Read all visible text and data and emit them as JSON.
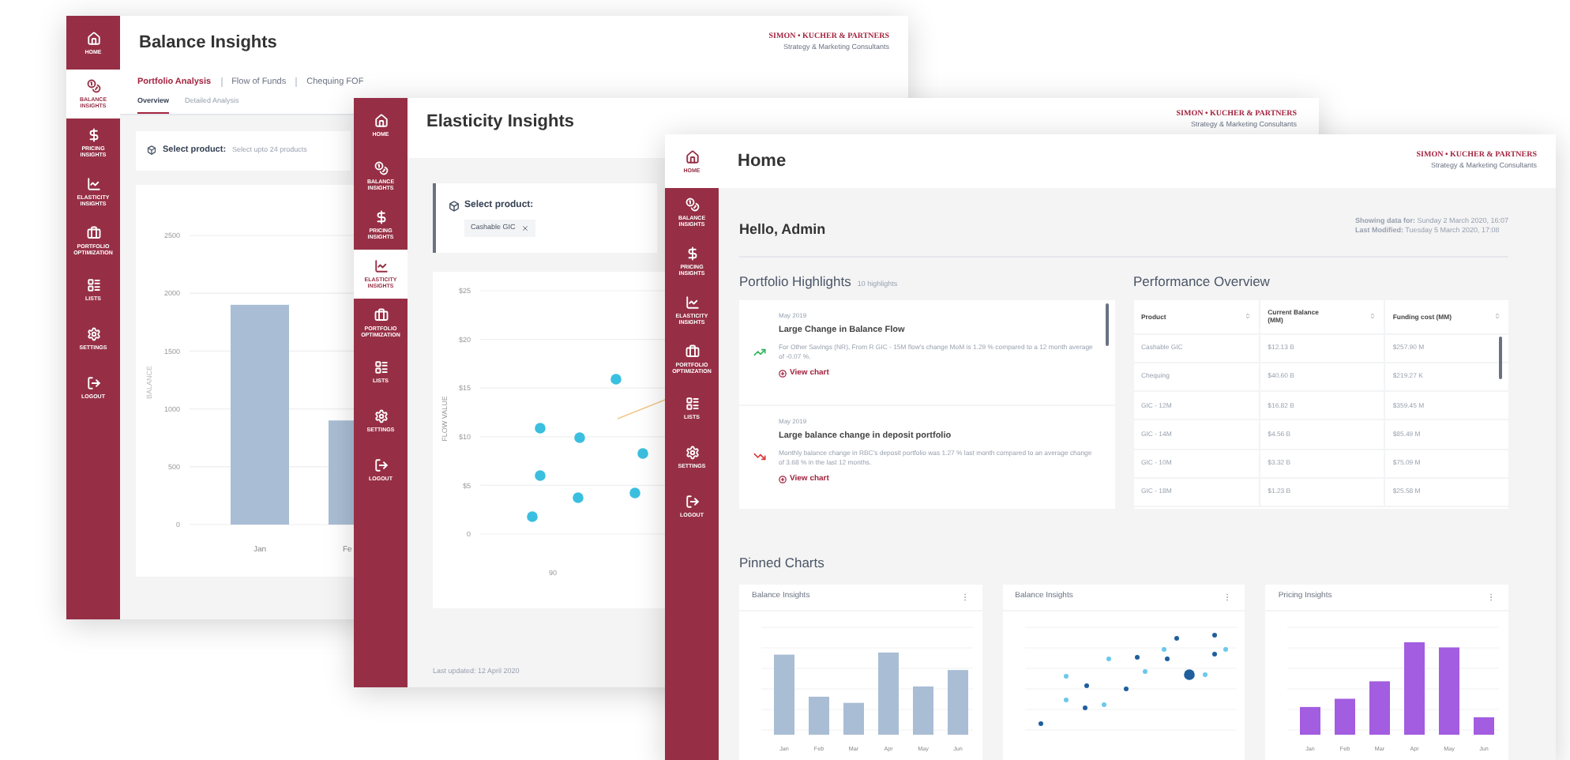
{
  "windows": [
    {
      "kind": "balance",
      "title": "Balance Insights",
      "logo": {
        "name": "SIMON • KUCHER & PARTNERS",
        "tagline": "Strategy & Marketing Consultants"
      },
      "sidebar": [
        {
          "label": "HOME",
          "selected": false
        },
        {
          "label": "BALANCE INSIGHTS",
          "selected": true
        },
        {
          "label": "PRICING INSIGHTS",
          "selected": false
        },
        {
          "label": "ELASTICITY INSIGHTS",
          "selected": false
        },
        {
          "label": "PORTFOLIO OPTIMIZATION",
          "selected": false
        },
        {
          "label": "LISTS",
          "selected": false
        },
        {
          "label": "SETTINGS",
          "selected": false
        },
        {
          "label": "LOGOUT",
          "selected": false
        }
      ],
      "tabs": [
        {
          "label": "Portfolio Analysis",
          "selected": true
        },
        {
          "label": "Flow of Funds",
          "selected": false
        },
        {
          "label": "Chequing FOF",
          "selected": false
        }
      ],
      "subtabs": [
        {
          "label": "Overview",
          "selected": true
        },
        {
          "label": "Detailed Analysis",
          "selected": false
        }
      ],
      "product_select": {
        "label": "Select product:",
        "placeholder": "Select upto 24 products"
      },
      "chart": {
        "chart_data": {
          "type": "bar",
          "grid": true,
          "ylabel": "BALANCE",
          "categories": [
            "Jan",
            "Fe"
          ],
          "values": [
            1900,
            900
          ],
          "ylim": [
            0,
            2500
          ],
          "yticks": [
            0,
            500,
            1000,
            1500,
            2000,
            2500
          ]
        }
      }
    },
    {
      "kind": "elasticity",
      "title": "Elasticity Insights",
      "logo": {
        "name": "SIMON • KUCHER & PARTNERS",
        "tagline": "Strategy & Marketing Consultants"
      },
      "sidebar": [
        {
          "label": "HOME",
          "selected": false
        },
        {
          "label": "BALANCE INSIGHTS",
          "selected": false
        },
        {
          "label": "PRICING INSIGHTS",
          "selected": false
        },
        {
          "label": "ELASTICITY INSIGHTS",
          "selected": true
        },
        {
          "label": "PORTFOLIO OPTIMIZATION",
          "selected": false
        },
        {
          "label": "LISTS",
          "selected": false
        },
        {
          "label": "SETTINGS",
          "selected": false
        },
        {
          "label": "LOGOUT",
          "selected": false
        }
      ],
      "product_select": {
        "label": "Select product:",
        "chips": [
          "Cashable GIC"
        ]
      },
      "scatter": {
        "ylabel": "FLOW VALUE",
        "yticks": [
          "$25",
          "$20",
          "$15",
          "$10",
          "$5",
          "0"
        ],
        "xticks": [
          "90"
        ]
      },
      "footer": "Last updated: 12 April 2020"
    },
    {
      "kind": "home",
      "title": "Home",
      "logo": {
        "name": "SIMON • KUCHER & PARTNERS",
        "tagline": "Strategy & Marketing Consultants"
      },
      "sidebar": [
        {
          "label": "HOME",
          "selected": true
        },
        {
          "label": "BALANCE INSIGHTS",
          "selected": false
        },
        {
          "label": "PRICING INSIGHTS",
          "selected": false
        },
        {
          "label": "ELASTICITY INSIGHTS",
          "selected": false
        },
        {
          "label": "PORTFOLIO OPTIMIZATION",
          "selected": false
        },
        {
          "label": "LISTS",
          "selected": false
        },
        {
          "label": "SETTINGS",
          "selected": false
        },
        {
          "label": "LOGOUT",
          "selected": false
        }
      ],
      "greeting": "Hello, Admin",
      "meta": [
        "**Showing data for:** Sunday 2 March 2020, 16:07",
        "**Last Modified:** Tuesday 5 March 2020, 17:08"
      ],
      "highlights": {
        "title": "Portfolio Highlights",
        "count": "10 highlights",
        "items": [
          {
            "kind": "up",
            "date": "May 2019",
            "title": "Large Change in Balance Flow",
            "body": "For Other Savings (NR), From R GIC - 15M flow's change MoM is 1.29 % compared to a 12 month average of -0.07 %.",
            "link": "View chart"
          },
          {
            "kind": "down",
            "date": "May 2019",
            "title": "Large balance change in deposit portfolio",
            "body": "Monthly balance change in RBC's deposit portfolio was 1.27 % last month compared to an average change of 3.68 % in the last 12 months.",
            "link": "View chart"
          }
        ]
      },
      "performance": {
        "title": "Performance Overview",
        "columns": [
          "Product",
          "Current Balance (MM)",
          "Funding cost (MM)"
        ],
        "rows": [
          [
            "Cashable GIC",
            "$12.13 B",
            "$257.90 M"
          ],
          [
            "Chequing",
            "$40.60 B",
            "$219.27 K"
          ],
          [
            "GIC - 12M",
            "$16.82 B",
            "$359.45 M"
          ],
          [
            "GIC - 14M",
            "$4.56 B",
            "$85.49 M"
          ],
          [
            "GIC - 10M",
            "$3.32 B",
            "$75.09 M"
          ],
          [
            "GIC - 18M",
            "$1.23 B",
            "$25.58 M"
          ]
        ]
      },
      "pinned": {
        "title": "Pinned Charts",
        "charts": [
          {
            "kind": "bar",
            "title": "Balance Insights",
            "color": "#a9bdd4",
            "categories": [
              "Jan",
              "Feb",
              "Mar",
              "Apr",
              "May",
              "Jun"
            ]
          },
          {
            "kind": "scatter",
            "title": "Balance Insights"
          },
          {
            "kind": "bar",
            "title": "Pricing Insights",
            "color": "#a35de0",
            "categories": [
              "Jan",
              "Feb",
              "Mar",
              "Apr",
              "May",
              "Jun"
            ]
          }
        ]
      }
    }
  ]
}
